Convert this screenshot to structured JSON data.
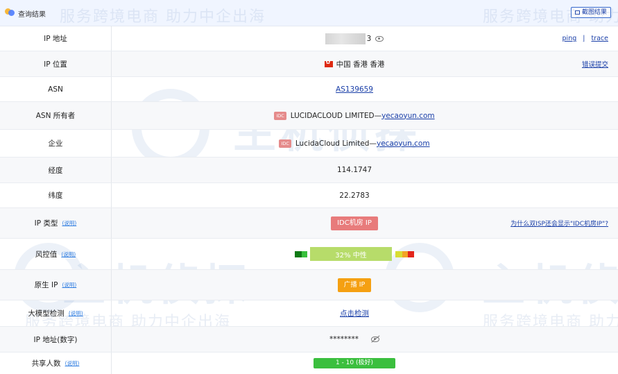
{
  "header": {
    "title": "查询结果",
    "button_label": "截图结果"
  },
  "watermark": {
    "slogan": "服务跨境电商 助力中企出海",
    "brand": "主机侦探"
  },
  "rows": {
    "ip": {
      "label": "IP 地址",
      "value_tail": "3",
      "links": [
        "ping",
        "trace"
      ],
      "separator": "|"
    },
    "location": {
      "label": "IP 位置",
      "value": "中国 香港 香港",
      "action": "错误提交"
    },
    "asn": {
      "label": "ASN",
      "value": "AS139659"
    },
    "asn_owner": {
      "label": "ASN 所有者",
      "badge": "IDC",
      "name": "LUCIDACLOUD LIMITED",
      "dash": "— ",
      "domain": "yecaoyun.com"
    },
    "company": {
      "label": "企业",
      "badge": "IDC",
      "name": "LucidaCloud Limited",
      "dash": "— ",
      "domain": "yecaoyun.com"
    },
    "longitude": {
      "label": "经度",
      "value": "114.1747"
    },
    "latitude": {
      "label": "纬度",
      "value": "22.2783"
    },
    "ip_type": {
      "label": "IP 类型",
      "explain": "(说明)",
      "value": "IDC机房 IP",
      "help": "为什么双ISP还会显示\"IDC机房IP\"?"
    },
    "risk": {
      "label": "风控值",
      "explain": "(说明)",
      "value": "32%  中性",
      "percent": 32
    },
    "native": {
      "label": "原生 IP",
      "explain": "(说明)",
      "value": "广播 IP"
    },
    "ai_check": {
      "label": "大模型检测",
      "explain": "(说明)",
      "value": "点击检测"
    },
    "ip_number": {
      "label": "IP 地址(数字)",
      "value": "********"
    },
    "shared": {
      "label": "共享人数",
      "explain": "(说明)",
      "value": "1 - 10 (极好)"
    }
  },
  "colors": {
    "header_bg": "#f0f5ff",
    "link": "#1a3fa8",
    "idc_pill": "#e87b7b",
    "broadcast_pill": "#f5a012",
    "good_pill": "#3bbf3e",
    "risk_neutral": "#b7dc6a"
  },
  "icons": [
    "logo-icon",
    "screenshot-icon",
    "eye-icon",
    "eye-slash-icon",
    "hk-flag-icon"
  ]
}
